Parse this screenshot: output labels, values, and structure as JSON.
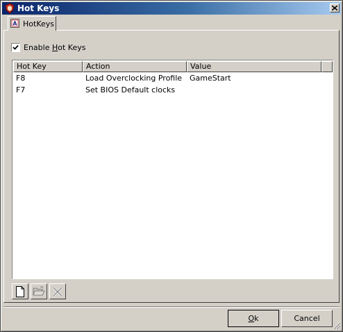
{
  "window": {
    "title": "Hot Keys",
    "icon": "app-shield-icon"
  },
  "tabs": [
    {
      "label": "HotKeys",
      "icon": "hotkeys-tab-icon",
      "selected": true
    }
  ],
  "enable_hotkeys": {
    "label_before": "Enable ",
    "label_underlined": "H",
    "label_after": "ot Keys",
    "checked": true
  },
  "table": {
    "columns": [
      "Hot Key",
      "Action",
      "Value"
    ],
    "rows": [
      {
        "key": "F8",
        "action": "Load Overclocking Profile",
        "value": "GameStart"
      },
      {
        "key": "F7",
        "action": "Set BIOS Default clocks",
        "value": ""
      }
    ]
  },
  "toolbar": {
    "new_icon": "new-document-icon",
    "open_icon": "open-folder-icon",
    "delete_icon": "delete-x-icon"
  },
  "buttons": {
    "ok_underlined": "O",
    "ok_rest": "k",
    "cancel": "Cancel"
  }
}
